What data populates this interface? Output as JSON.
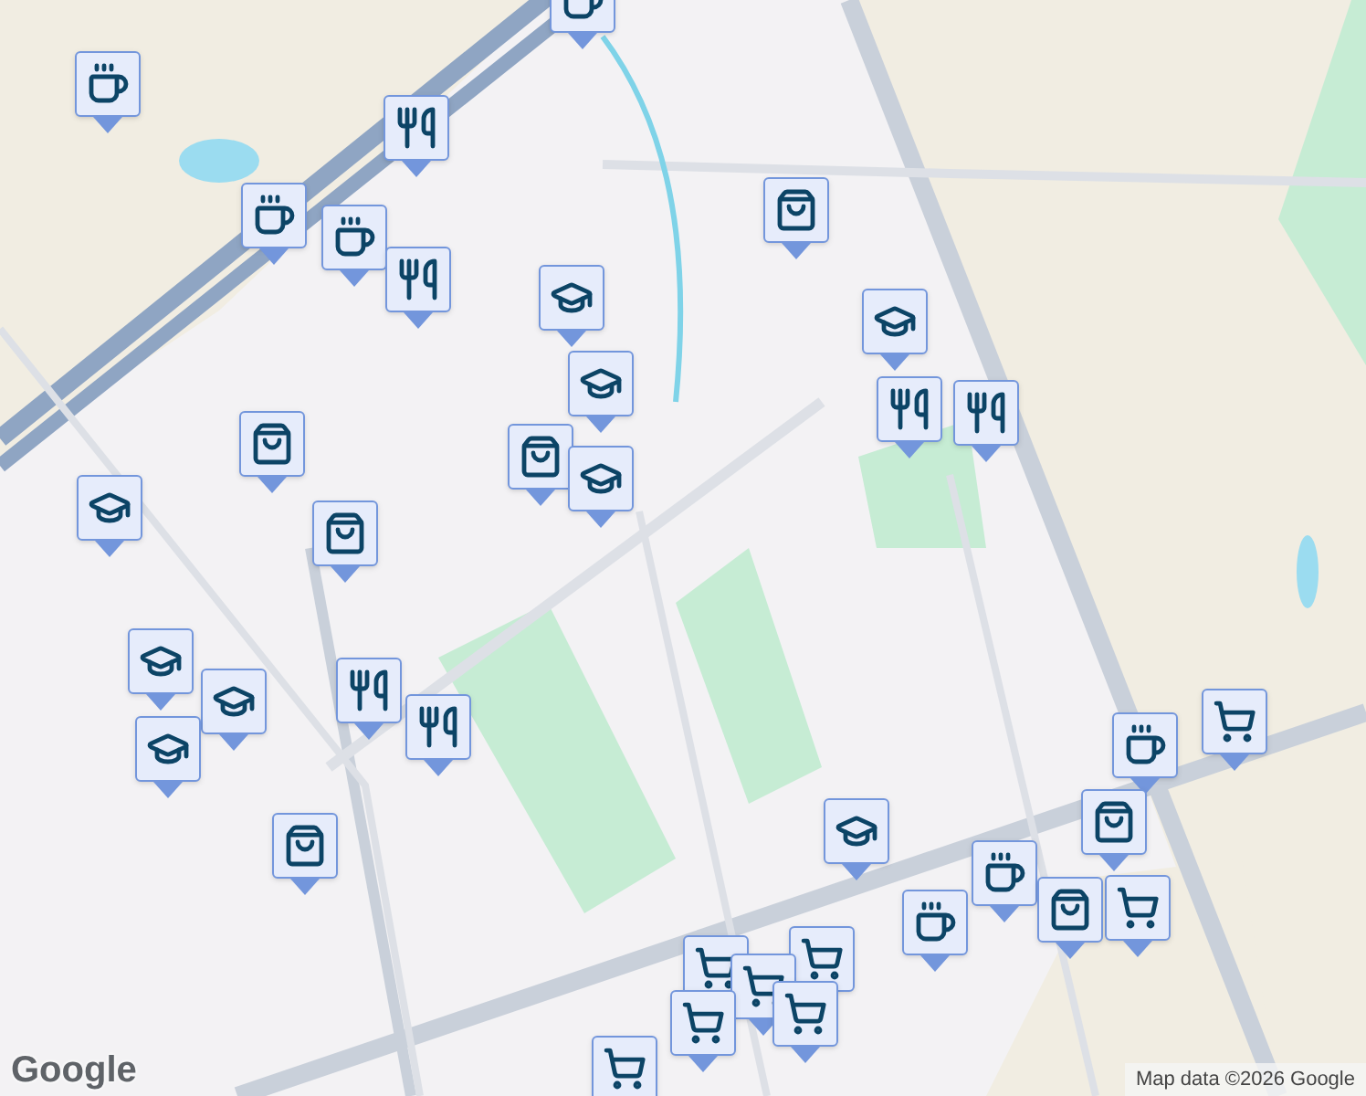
{
  "markers": [
    {
      "kind": "cafe"
    },
    {
      "kind": "restaurant"
    },
    {
      "kind": "cafe"
    },
    {
      "kind": "cafe"
    },
    {
      "kind": "restaurant"
    },
    {
      "kind": "school"
    },
    {
      "kind": "school"
    },
    {
      "kind": "shopping"
    },
    {
      "kind": "school"
    },
    {
      "kind": "shopping"
    },
    {
      "kind": "school"
    },
    {
      "kind": "shopping"
    },
    {
      "kind": "shopping"
    },
    {
      "kind": "cafe"
    },
    {
      "kind": "school"
    },
    {
      "kind": "restaurant"
    },
    {
      "kind": "restaurant"
    },
    {
      "kind": "school"
    },
    {
      "kind": "school"
    },
    {
      "kind": "school"
    },
    {
      "kind": "restaurant"
    },
    {
      "kind": "restaurant"
    },
    {
      "kind": "shopping"
    },
    {
      "kind": "school"
    },
    {
      "kind": "cafe"
    },
    {
      "kind": "grocery"
    },
    {
      "kind": "shopping"
    },
    {
      "kind": "grocery"
    },
    {
      "kind": "cafe"
    },
    {
      "kind": "shopping"
    },
    {
      "kind": "cafe"
    },
    {
      "kind": "grocery"
    },
    {
      "kind": "grocery"
    },
    {
      "kind": "grocery"
    },
    {
      "kind": "grocery"
    },
    {
      "kind": "grocery"
    },
    {
      "kind": "grocery"
    }
  ],
  "logo": "Google",
  "attribution": "Map data ©2026 Google"
}
